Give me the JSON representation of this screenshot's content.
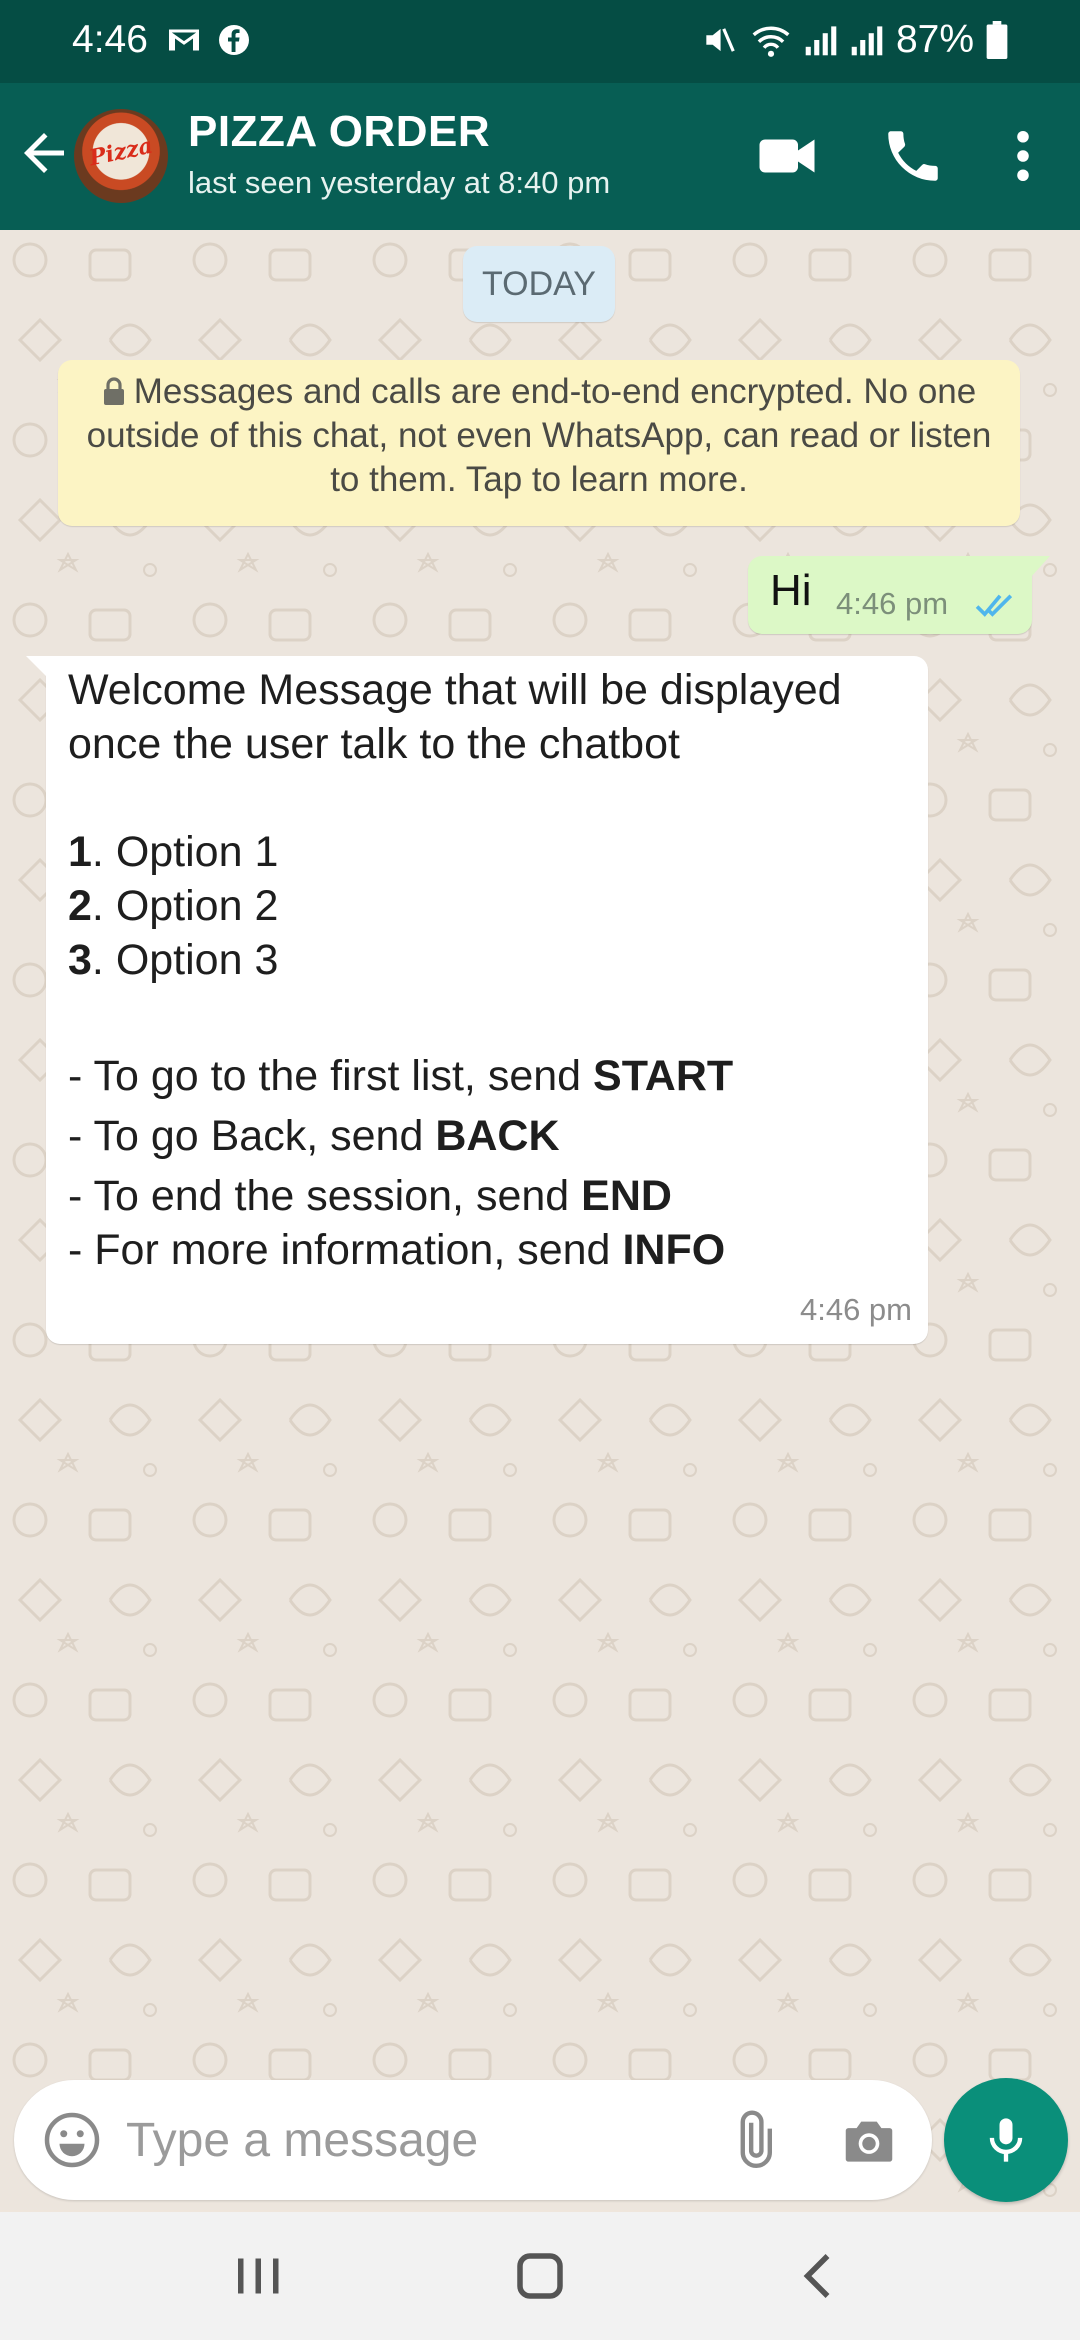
{
  "status_bar": {
    "time": "4:46",
    "left_icons": [
      "gmail-icon",
      "facebook-icon"
    ],
    "right_icons": [
      "mute-icon",
      "wifi-icon",
      "signal-icon",
      "signal-icon",
      "battery-icon"
    ],
    "battery": "87%"
  },
  "header": {
    "title": "PIZZA ORDER",
    "subtitle": "last seen yesterday at 8:40 pm",
    "avatar_text": "Pizza",
    "actions": [
      "video-call-icon",
      "voice-call-icon",
      "more-options-icon"
    ]
  },
  "chat": {
    "date_label": "TODAY",
    "encryption_notice": "Messages and calls are end-to-end encrypted. No one outside of this chat, not even WhatsApp, can read or listen to them. Tap to learn more.",
    "outgoing": {
      "text": "Hi",
      "time": "4:46 pm",
      "status": "read"
    },
    "incoming": {
      "welcome_line1": "Welcome Message that will be displayed",
      "welcome_line2": "once the user talk to the chatbot",
      "options": [
        {
          "num": "1",
          "label": ". Option 1"
        },
        {
          "num": "2",
          "label": ". Option 2"
        },
        {
          "num": "3",
          "label": ". Option 3"
        }
      ],
      "commands": [
        {
          "prefix": "- To go to the first list, send ",
          "keyword": "START"
        },
        {
          "prefix": "- To go Back, send ",
          "keyword": "BACK"
        },
        {
          "prefix": "- To end the session, send ",
          "keyword": "END"
        },
        {
          "prefix": "- For more information, send ",
          "keyword": "INFO"
        }
      ],
      "time": "4:46 pm"
    }
  },
  "composer": {
    "placeholder": "Type a message",
    "value": ""
  },
  "colors": {
    "status_bar": "#054d44",
    "app_bar": "#075e54",
    "outgoing_bubble": "#dcf8c6",
    "incoming_bubble": "#ffffff",
    "notice_bg": "#fcf4c4",
    "date_pill": "#dbecf6",
    "mic_button": "#0a8f7a",
    "read_ticks": "#4fb6ec"
  }
}
